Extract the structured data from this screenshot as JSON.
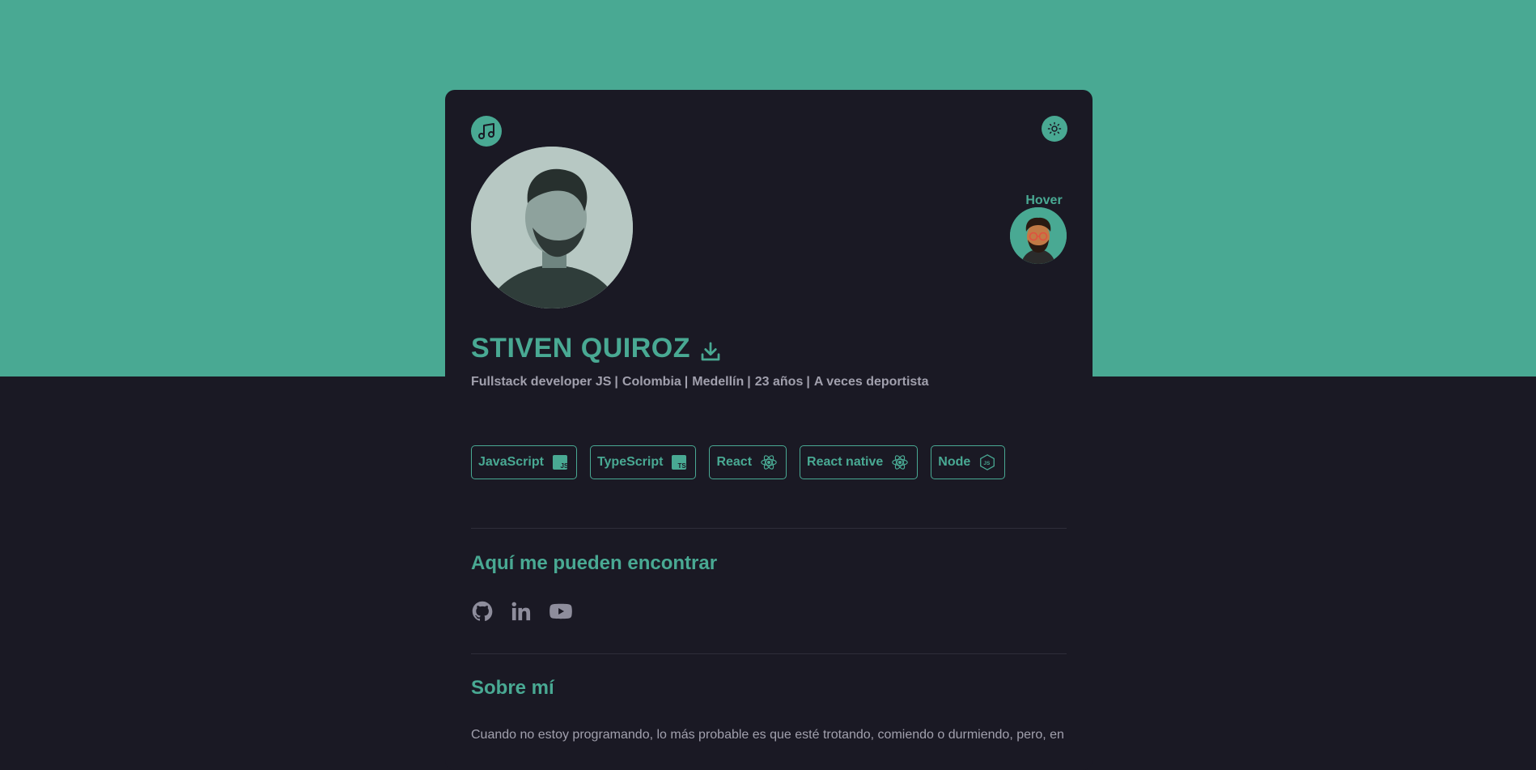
{
  "profile": {
    "name": "STIVEN QUIROZ",
    "meta": [
      "Fullstack developer JS",
      "Colombia",
      "Medellín",
      "23 años",
      "A veces deportista"
    ],
    "separator": "|",
    "hover_label": "Hover"
  },
  "tags": [
    {
      "label": "JavaScript",
      "icon": "javascript-icon"
    },
    {
      "label": "TypeScript",
      "icon": "typescript-icon"
    },
    {
      "label": "React",
      "icon": "react-icon"
    },
    {
      "label": "React native",
      "icon": "react-icon"
    },
    {
      "label": "Node",
      "icon": "node-icon"
    }
  ],
  "sections": {
    "find_me_title": "Aquí me pueden encontrar",
    "about_title": "Sobre mí",
    "about_text": "Cuando no estoy programando, lo más probable es que esté trotando, comiendo o durmiendo, pero, en"
  },
  "socials": [
    "github-icon",
    "linkedin-icon",
    "youtube-icon"
  ],
  "colors": {
    "accent": "#49a993",
    "background": "#1a1924",
    "muted_text": "#a1a0ad"
  }
}
